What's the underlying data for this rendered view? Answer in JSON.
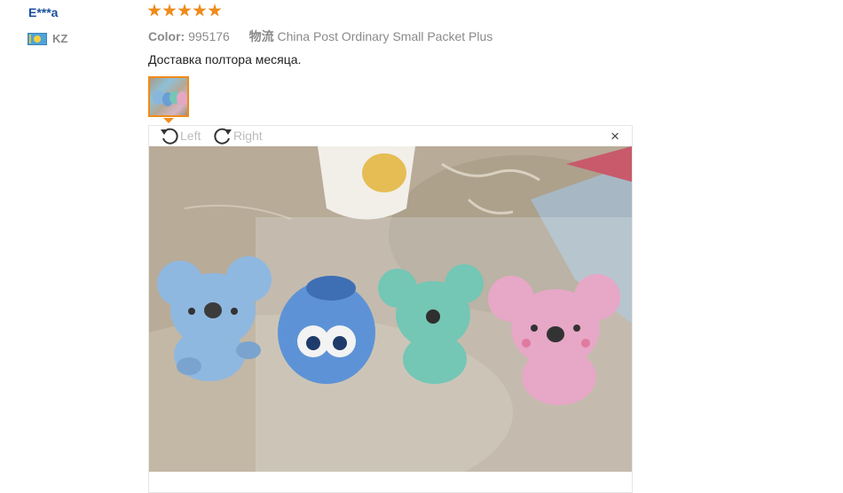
{
  "review": {
    "user_name": "E***a",
    "country_code": "KZ",
    "country_flag_icon": "kazakhstan-flag-icon",
    "rating": 5,
    "color_label": "Color:",
    "color_value": "995176",
    "shipping_label": "物流",
    "shipping_value": "China Post Ordinary Small Packet Plus",
    "feedback_text": "Доставка полтора месяца."
  },
  "viewer": {
    "rotate_left_label": "Left",
    "rotate_right_label": "Right",
    "rotate_left_icon": "rotate-left-icon",
    "rotate_right_icon": "rotate-right-icon",
    "close_label": "×",
    "close_icon": "close-icon"
  },
  "colors": {
    "accent": "#ef8b1b",
    "name": "#1a4f9c"
  }
}
